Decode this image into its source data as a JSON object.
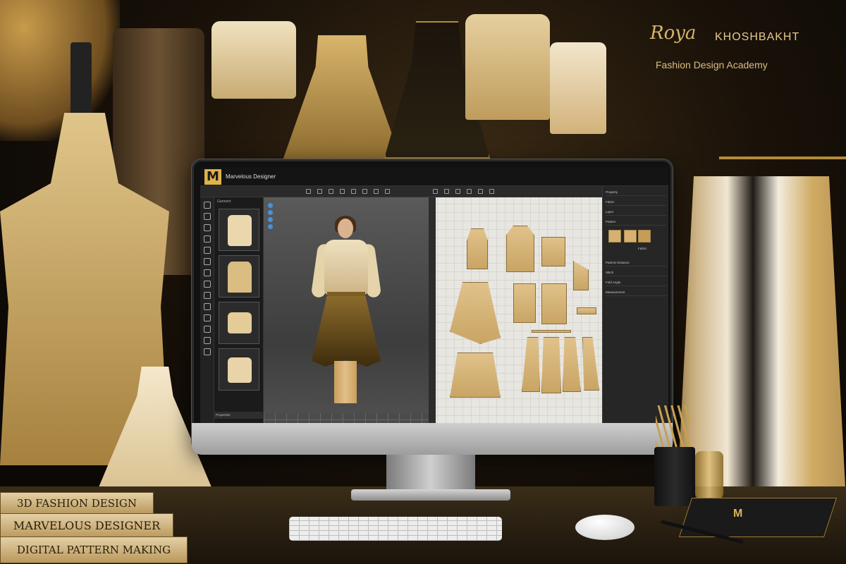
{
  "brand": {
    "signature": "Roya",
    "name": "KHOSHBAKHT",
    "subtitle": "Fashion Design Academy"
  },
  "app": {
    "title": "Marvelous Designer",
    "logo_letter": "M",
    "library_tab": "Garment",
    "library_footer": "Properties",
    "property_panel": {
      "rows": [
        "Property",
        "Fabric",
        "Layer",
        "Pattern",
        "Particle Distance",
        "Stitch",
        "Fold Angle",
        "Measurement"
      ],
      "swatch_label": "Fabric"
    }
  },
  "books": [
    {
      "title": "3D FASHION DESIGN"
    },
    {
      "title": "MARVELOUS DESIGNER"
    },
    {
      "title": "DIGITAL PATTERN MAKING"
    }
  ],
  "notebook": {
    "logo_letter": "M"
  },
  "colors": {
    "gold": "#d7b46c",
    "accent_blue": "#4a8fd8",
    "panel_dark": "#1e1e1e"
  },
  "icons": [
    "gear-icon",
    "select-icon",
    "move-icon",
    "fold-icon",
    "sewing-icon",
    "zoom-icon"
  ]
}
